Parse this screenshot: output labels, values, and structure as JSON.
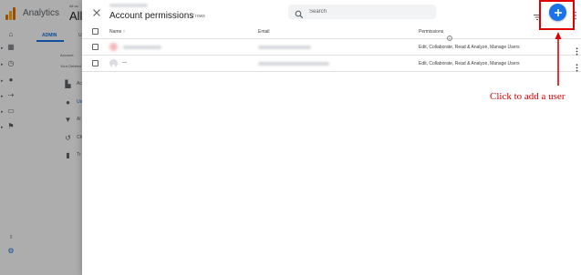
{
  "app": {
    "title": "Analytics",
    "account_label_small": "All ac",
    "account_label_big": "All V"
  },
  "admin": {
    "tab_admin": "ADMIN",
    "tab_user": "U",
    "account_label": "Account",
    "deleted_note": "Your Deleted",
    "items": [
      {
        "icon": "building-icon",
        "label": "Ac"
      },
      {
        "icon": "users-icon",
        "label": "Us"
      },
      {
        "icon": "filter-icon",
        "label": "Al"
      },
      {
        "icon": "history-icon",
        "label": "Ch"
      },
      {
        "icon": "trash-icon",
        "label": "Tr"
      }
    ]
  },
  "dialog": {
    "title": "Account permissions",
    "row_count": "2 rows",
    "search_placeholder": "Search",
    "accent_color": "#1a73e8"
  },
  "table": {
    "columns": {
      "name": "Name ↑",
      "email": "Email",
      "permissions": "Permissions"
    },
    "rows": [
      {
        "name": "",
        "email": "",
        "permissions": "Edit, Collaborate, Read & Analyze, Manage Users"
      },
      {
        "name": "—",
        "email": "",
        "permissions": "Edit, Collaborate, Read & Analyze, Manage Users"
      }
    ]
  },
  "annotation": {
    "text": "Click to add a user",
    "color": "#e00000"
  }
}
